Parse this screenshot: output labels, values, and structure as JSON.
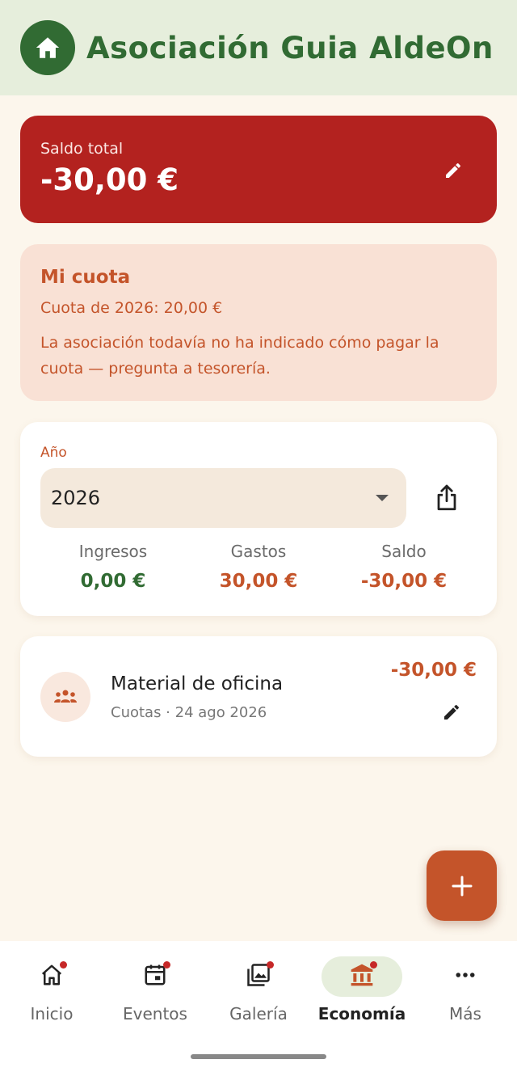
{
  "header": {
    "title": "Asociación Guia AldeOn",
    "logo_icon": "house-icon"
  },
  "balance": {
    "label": "Saldo total",
    "value": "-30,00 €",
    "color": "#b3221f"
  },
  "quota": {
    "title": "Mi cuota",
    "amount_text": "Cuota de 2026: 20,00 €",
    "note": "La asociación todavía no ha indicado cómo pagar la cuota — pregunta a tesorería."
  },
  "year_summary": {
    "label": "Año",
    "selected_year": "2026",
    "stats": [
      {
        "label": "Ingresos",
        "value": "0,00 €",
        "color": "#316b33"
      },
      {
        "label": "Gastos",
        "value": "30,00 €",
        "color": "#c4542a"
      },
      {
        "label": "Saldo",
        "value": "-30,00 €",
        "color": "#c4542a"
      }
    ]
  },
  "transactions": [
    {
      "title": "Material de oficina",
      "subtitle": "Cuotas · 24 ago 2026",
      "amount": "-30,00 €",
      "icon": "group-icon"
    }
  ],
  "fab": {
    "label": "+"
  },
  "nav": {
    "items": [
      {
        "label": "Inicio",
        "icon": "home-icon",
        "badge": true,
        "active": false
      },
      {
        "label": "Eventos",
        "icon": "calendar-icon",
        "badge": true,
        "active": false
      },
      {
        "label": "Galería",
        "icon": "gallery-icon",
        "badge": true,
        "active": false
      },
      {
        "label": "Economía",
        "icon": "bank-icon",
        "badge": true,
        "active": true
      },
      {
        "label": "Más",
        "icon": "more-icon",
        "badge": false,
        "active": false
      }
    ]
  },
  "colors": {
    "primary_green": "#316b33",
    "accent_orange": "#c4542a",
    "danger_red": "#b3221f"
  }
}
